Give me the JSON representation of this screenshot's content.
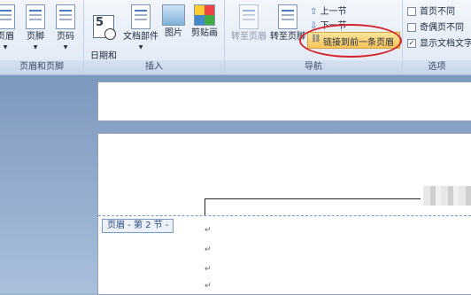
{
  "ribbon": {
    "groups": {
      "header_footer": {
        "label": "页眉和页脚",
        "buttons": [
          "页眉",
          "页脚",
          "页码"
        ]
      },
      "insert": {
        "label": "插入",
        "buttons": [
          "日期和\n时间",
          "文档部件",
          "图片",
          "剪贴画"
        ]
      },
      "navigation": {
        "label": "导航",
        "goto_header": "转至页眉",
        "goto_footer": "转至页脚",
        "prev_section": "上一节",
        "next_section": "下一节",
        "link_previous": "链接到前一条页眉"
      },
      "options": {
        "label": "选项",
        "first_page_diff": "首页不同",
        "odd_even_diff": "奇偶页不同",
        "show_doc_text": "显示文档文字"
      }
    },
    "arrow_glyph": "▼",
    "check_glyph": "✓"
  },
  "document": {
    "header_tag": "页眉 - 第 2 节 -",
    "paragraph_mark": "↵"
  }
}
